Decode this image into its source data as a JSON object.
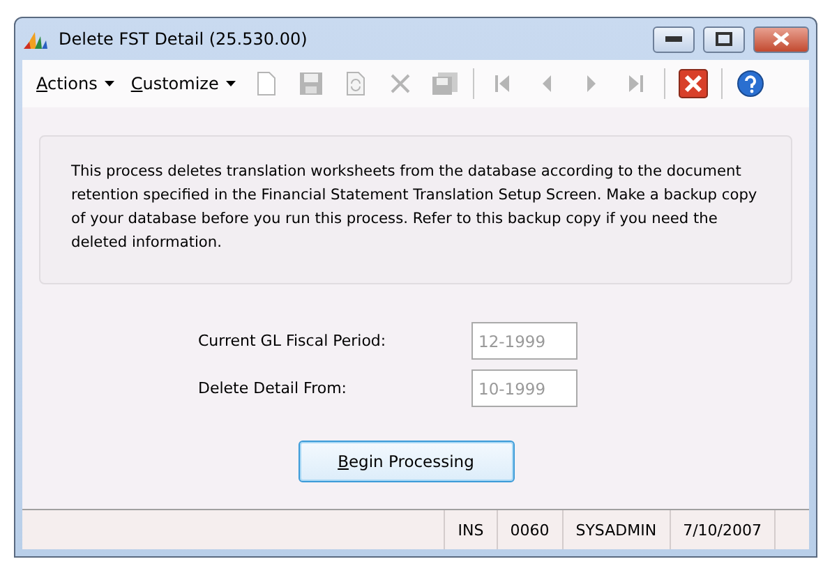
{
  "window": {
    "title": "Delete FST Detail (25.530.00)"
  },
  "menus": [
    {
      "label": "Actions",
      "underline_first": true
    },
    {
      "label": "Customize",
      "underline_first": true
    }
  ],
  "toolbar": [
    {
      "kind": "new",
      "disabled": true
    },
    {
      "kind": "save",
      "disabled": true
    },
    {
      "kind": "copy",
      "disabled": true
    },
    {
      "kind": "delete",
      "disabled": true
    },
    {
      "kind": "paste",
      "disabled": true
    },
    {
      "kind": "sep"
    },
    {
      "kind": "first",
      "disabled": true
    },
    {
      "kind": "prev",
      "disabled": true
    },
    {
      "kind": "next",
      "disabled": true
    },
    {
      "kind": "last",
      "disabled": true
    },
    {
      "kind": "sep"
    },
    {
      "kind": "close",
      "disabled": false
    },
    {
      "kind": "sep"
    },
    {
      "kind": "help",
      "disabled": false
    }
  ],
  "message": "This process deletes translation worksheets from the database according to the document retention specified in the Financial Statement Translation Setup Screen.  Make a backup copy of your database before you run this process.  Refer to this backup copy  if you need the deleted information.",
  "fields": [
    {
      "label": "Current GL Fiscal Period:",
      "value": "12-1999",
      "disabled": true
    },
    {
      "label": "Delete Detail From:",
      "value": "10-1999",
      "disabled": true
    }
  ],
  "button": {
    "label": "Begin Processing",
    "underline_first": true
  },
  "status_bar": [
    "INS",
    "0060",
    "SYSADMIN",
    "7/10/2007"
  ]
}
